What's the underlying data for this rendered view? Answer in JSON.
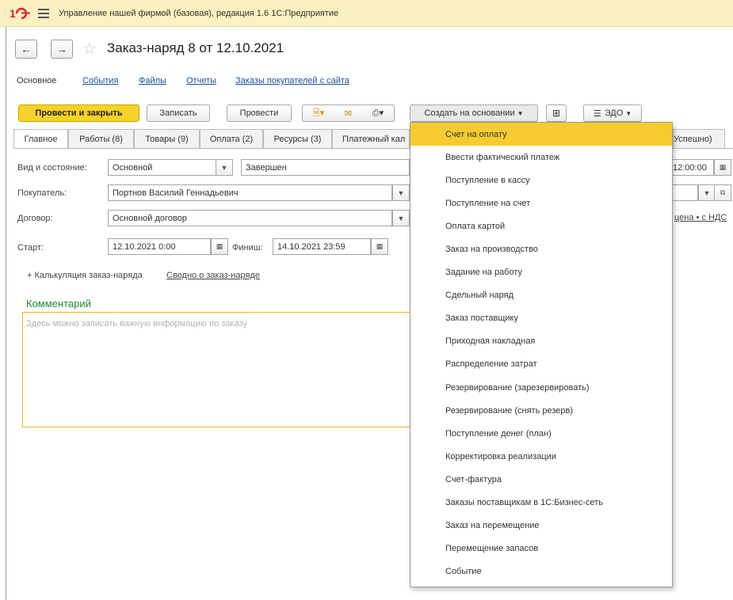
{
  "window": {
    "title": "Управление нашей фирмой (базовая), редакция 1.6 1С:Предприятие"
  },
  "document": {
    "title": "Заказ-наряд 8 от 12.10.2021"
  },
  "section_nav": [
    "Основное",
    "События",
    "Файлы",
    "Отчеты",
    "Заказы покупателей с сайта"
  ],
  "toolbar": {
    "post_close": "Провести и закрыть",
    "save": "Записать",
    "post": "Провести",
    "create_based_on": "Создать на основании",
    "edo": "ЭДО"
  },
  "tabs": [
    "Главное",
    "Работы (8)",
    "Товары (9)",
    "Оплата (2)",
    "Ресурсы (3)",
    "Платежный кал"
  ],
  "tab_right_fragment": "Успешно)",
  "form": {
    "kind_label": "Вид и состояние:",
    "kind_value": "Основной",
    "status_value": "Завершен",
    "time_fragment": "12:00:00",
    "buyer_label": "Покупатель:",
    "buyer_value": "Портнов Василий Геннадьевич",
    "contract_label": "Договор:",
    "contract_value": "Основной договор",
    "price_link": "цена • с НДС",
    "start_label": "Старт:",
    "start_value": "12.10.2021  0:00",
    "finish_label": "Финиш:",
    "finish_value": "14.10.2021 23:59",
    "calc_link": "+ Калькуляция заказ-наряда",
    "summary_link": "Сводно о заказ-наряде"
  },
  "comment": {
    "title": "Комментарий",
    "placeholder": "Здесь можно записать важную информацию по заказу"
  },
  "dropdown": {
    "selected_index": 0,
    "items": [
      "Счет на оплату",
      "Ввести фактический платеж",
      "Поступление в кассу",
      "Поступление на счет",
      "Оплата картой",
      "Заказ на производство",
      "Задание на работу",
      "Сдельный наряд",
      "Заказ поставщику",
      "Приходная накладная",
      "Распределение затрат",
      "Резервирование (зарезервировать)",
      "Резервирование (снять резерв)",
      "Поступление денег (план)",
      "Корректировка реализации",
      "Счет-фактура",
      "Заказы поставщикам в 1С:Бизнес-сеть",
      "Заказ на перемещение",
      "Перемещение запасов",
      "Событие"
    ]
  },
  "colors": {
    "titlebar": "#fbf0c0",
    "primary_button": "#f6d22a",
    "selected_item": "#f6cb2e",
    "comment_title": "#1f8a3a",
    "link": "#1c4f9c"
  }
}
